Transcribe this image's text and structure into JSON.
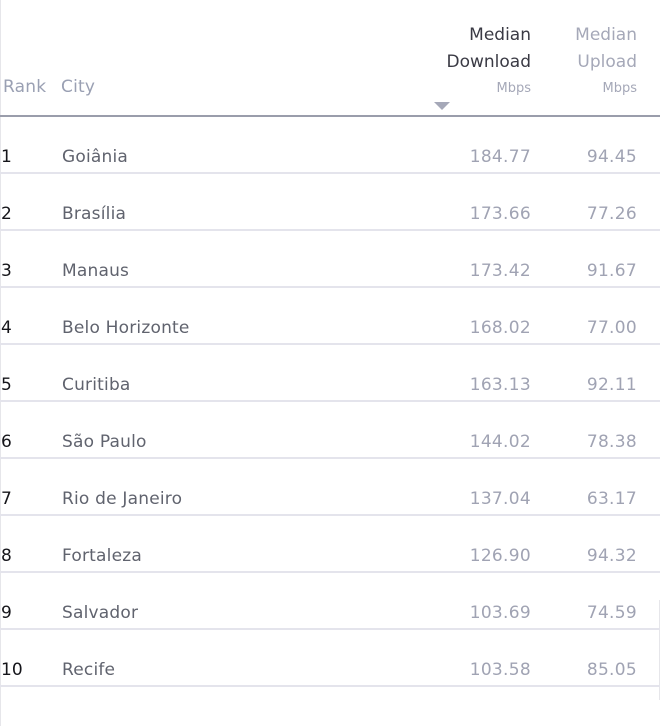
{
  "table": {
    "headers": {
      "rank": "Rank",
      "city": "City",
      "download": {
        "line1": "Median",
        "line2": "Download",
        "unit": "Mbps",
        "sorted": "descending"
      },
      "upload": {
        "line1": "Median",
        "line2": "Upload",
        "unit": "Mbps"
      }
    },
    "rows": [
      {
        "rank": "1",
        "city": "Goiânia",
        "download": "184.77",
        "upload": "94.45"
      },
      {
        "rank": "2",
        "city": "Brasília",
        "download": "173.66",
        "upload": "77.26"
      },
      {
        "rank": "3",
        "city": "Manaus",
        "download": "173.42",
        "upload": "91.67"
      },
      {
        "rank": "4",
        "city": "Belo Horizonte",
        "download": "168.02",
        "upload": "77.00"
      },
      {
        "rank": "5",
        "city": "Curitiba",
        "download": "163.13",
        "upload": "92.11"
      },
      {
        "rank": "6",
        "city": "São Paulo",
        "download": "144.02",
        "upload": "78.38"
      },
      {
        "rank": "7",
        "city": "Rio de Janeiro",
        "download": "137.04",
        "upload": "63.17"
      },
      {
        "rank": "8",
        "city": "Fortaleza",
        "download": "126.90",
        "upload": "94.32"
      },
      {
        "rank": "9",
        "city": "Salvador",
        "download": "103.69",
        "upload": "74.59"
      },
      {
        "rank": "10",
        "city": "Recife",
        "download": "103.58",
        "upload": "85.05"
      }
    ]
  },
  "colors": {
    "header_active": "#3a3a44",
    "header_muted": "#a5a8b8",
    "rank_text": "#15151a",
    "city_text": "#60636e",
    "value_text": "#a0a3b3",
    "header_rule": "#9a9dab",
    "row_rule": "#e4e4ec"
  }
}
